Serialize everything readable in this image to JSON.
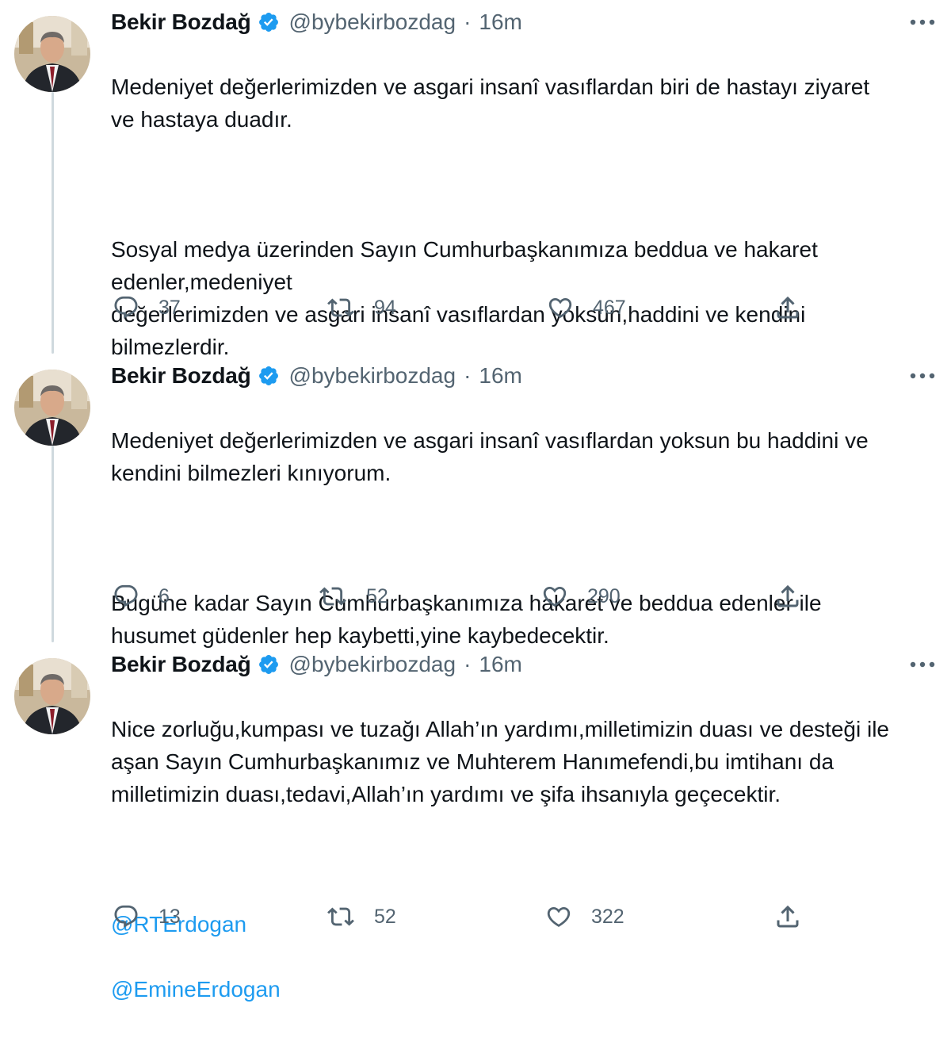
{
  "tweets": [
    {
      "author_name": "Bekir Bozdağ",
      "handle": "@bybekirbozdag",
      "separator": "·",
      "time": "16m",
      "paragraphs": [
        "Medeniyet değerlerimizden ve asgari insanî vasıflardan biri de hastayı ziyaret ve hastaya duadır.",
        "Sosyal medya üzerinden Sayın Cumhurbaşkanımıza beddua ve hakaret edenler,medeniyet\ndeğerlerimizden ve asgari insanî vasıflardan yoksun,haddini ve kendini bilmezlerdir."
      ],
      "replies": "37",
      "retweets": "94",
      "likes": "467"
    },
    {
      "author_name": "Bekir Bozdağ",
      "handle": "@bybekirbozdag",
      "separator": "·",
      "time": "16m",
      "paragraphs": [
        "Medeniyet değerlerimizden ve asgari insanî vasıflardan yoksun bu haddini ve kendini bilmezleri kınıyorum.",
        "Bugüne kadar Sayın Cumhurbaşkanımıza hakaret ve beddua edenler ile husumet güdenler hep kaybetti,yine kaybedecektir."
      ],
      "replies": "6",
      "retweets": "52",
      "likes": "290"
    },
    {
      "author_name": "Bekir Bozdağ",
      "handle": "@bybekirbozdag",
      "separator": "·",
      "time": "16m",
      "paragraphs": [
        "Nice zorluğu,kumpası ve tuzağı Allah’ın yardımı,milletimizin duası ve desteği ile aşan Sayın Cumhurbaşkanımız ve Muhterem Hanımefendi,bu imtihanı da milletimizin duası,tedavi,Allah’ın yardımı ve şifa ihsanıyla geçecektir."
      ],
      "mentions": [
        "@RTErdogan",
        "@EmineErdogan"
      ],
      "replies": "13",
      "retweets": "52",
      "likes": "322"
    }
  ],
  "icons": {
    "reply": "reply-icon",
    "retweet": "retweet-icon",
    "like": "heart-icon",
    "share": "share-icon",
    "more": "more-icon",
    "verified": "verified-badge-icon"
  },
  "colors": {
    "text": "#0f1419",
    "secondary": "#536471",
    "accent": "#1d9bf0",
    "thread_line": "#cfd9de"
  }
}
